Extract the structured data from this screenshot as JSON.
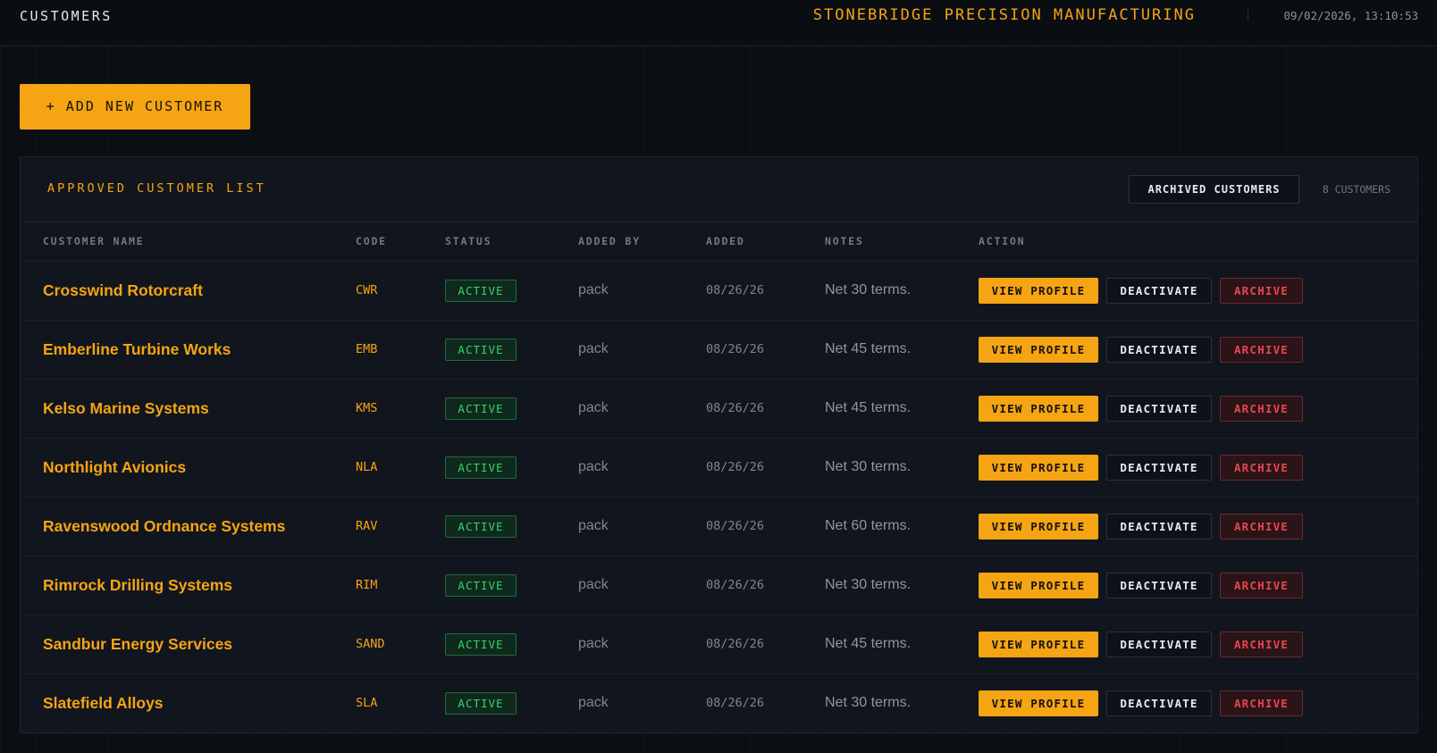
{
  "header": {
    "page_title": "CUSTOMERS",
    "company": "STONEBRIDGE PRECISION MANUFACTURING",
    "datetime": "09/02/2026, 13:10:53"
  },
  "actions": {
    "add_label": "+ ADD NEW CUSTOMER"
  },
  "panel": {
    "title": "APPROVED CUSTOMER LIST",
    "archived_label": "ARCHIVED CUSTOMERS",
    "count": "8 CUSTOMERS"
  },
  "table": {
    "columns": [
      "CUSTOMER NAME",
      "CODE",
      "STATUS",
      "ADDED BY",
      "ADDED",
      "NOTES",
      "ACTION"
    ],
    "action_labels": {
      "view": "VIEW PROFILE",
      "deactivate": "DEACTIVATE",
      "archive": "ARCHIVE"
    },
    "rows": [
      {
        "name": "Crosswind Rotorcraft",
        "code": "CWR",
        "status": "ACTIVE",
        "added_by": "pack",
        "added": "08/26/26",
        "notes": "Net 30 terms."
      },
      {
        "name": "Emberline Turbine Works",
        "code": "EMB",
        "status": "ACTIVE",
        "added_by": "pack",
        "added": "08/26/26",
        "notes": "Net 45 terms."
      },
      {
        "name": "Kelso Marine Systems",
        "code": "KMS",
        "status": "ACTIVE",
        "added_by": "pack",
        "added": "08/26/26",
        "notes": "Net 45 terms."
      },
      {
        "name": "Northlight Avionics",
        "code": "NLA",
        "status": "ACTIVE",
        "added_by": "pack",
        "added": "08/26/26",
        "notes": "Net 30 terms."
      },
      {
        "name": "Ravenswood Ordnance Systems",
        "code": "RAV",
        "status": "ACTIVE",
        "added_by": "pack",
        "added": "08/26/26",
        "notes": "Net 60 terms."
      },
      {
        "name": "Rimrock Drilling Systems",
        "code": "RIM",
        "status": "ACTIVE",
        "added_by": "pack",
        "added": "08/26/26",
        "notes": "Net 30 terms."
      },
      {
        "name": "Sandbur Energy Services",
        "code": "SAND",
        "status": "ACTIVE",
        "added_by": "pack",
        "added": "08/26/26",
        "notes": "Net 45 terms."
      },
      {
        "name": "Slatefield Alloys",
        "code": "SLA",
        "status": "ACTIVE",
        "added_by": "pack",
        "added": "08/26/26",
        "notes": "Net 30 terms."
      }
    ]
  },
  "colors": {
    "accent": "#f5a413",
    "background": "#0b0e13",
    "panel": "#11151d",
    "status_active": "#37d26f",
    "danger": "#e8454f"
  }
}
